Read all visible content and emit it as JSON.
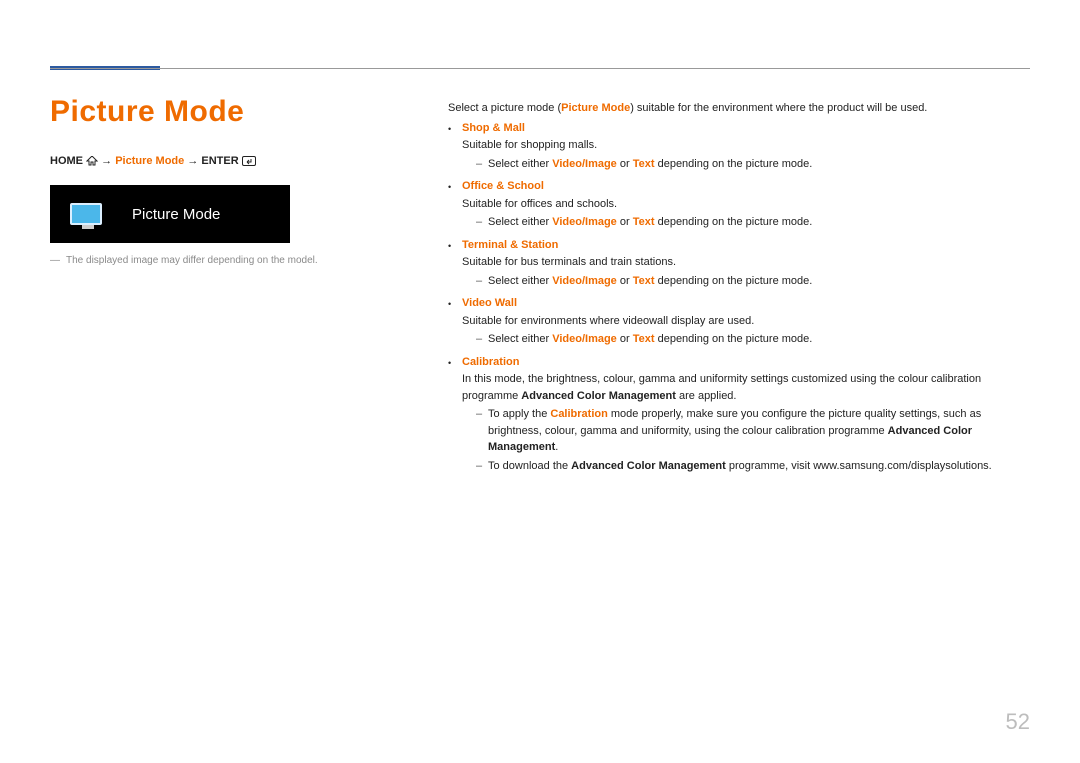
{
  "page_number": "52",
  "heading": "Picture Mode",
  "breadcrumb": {
    "home": "HOME",
    "arrow1": "→",
    "item": "Picture Mode",
    "arrow2": "→",
    "enter": "ENTER"
  },
  "preview_label": "Picture Mode",
  "footnote": "The displayed image may differ depending on the model.",
  "intro": {
    "prefix": "Select a picture mode (",
    "highlight": "Picture Mode",
    "suffix": ") suitable for the environment where the product will be used."
  },
  "option_phrase": {
    "pre": "Select either ",
    "a": "Video/Image",
    "mid": " or ",
    "b": "Text",
    "post": " depending on the picture mode."
  },
  "modes": {
    "shop": {
      "title": "Shop & Mall",
      "desc": "Suitable for shopping malls."
    },
    "office": {
      "title": "Office & School",
      "desc": "Suitable for offices and schools."
    },
    "terminal": {
      "title": "Terminal & Station",
      "desc": "Suitable for bus terminals and train stations."
    },
    "videowall": {
      "title": "Video Wall",
      "desc": "Suitable for environments where videowall display are used."
    }
  },
  "calibration": {
    "title": "Calibration",
    "desc_pre": "In this mode, the brightness, colour, gamma and uniformity settings customized using the colour calibration programme ",
    "acm": "Advanced Color Management",
    "desc_post": " are applied.",
    "sub1_pre": "To apply the ",
    "sub1_cal": "Calibration",
    "sub1_mid": " mode properly, make sure you configure the picture quality settings, such as brightness, colour, gamma and uniformity, using the colour calibration programme ",
    "sub1_acm": "Advanced Color Management",
    "sub1_end": ".",
    "sub2_pre": "To download the ",
    "sub2_acm": "Advanced Color Management",
    "sub2_post": " programme, visit www.samsung.com/displaysolutions."
  }
}
